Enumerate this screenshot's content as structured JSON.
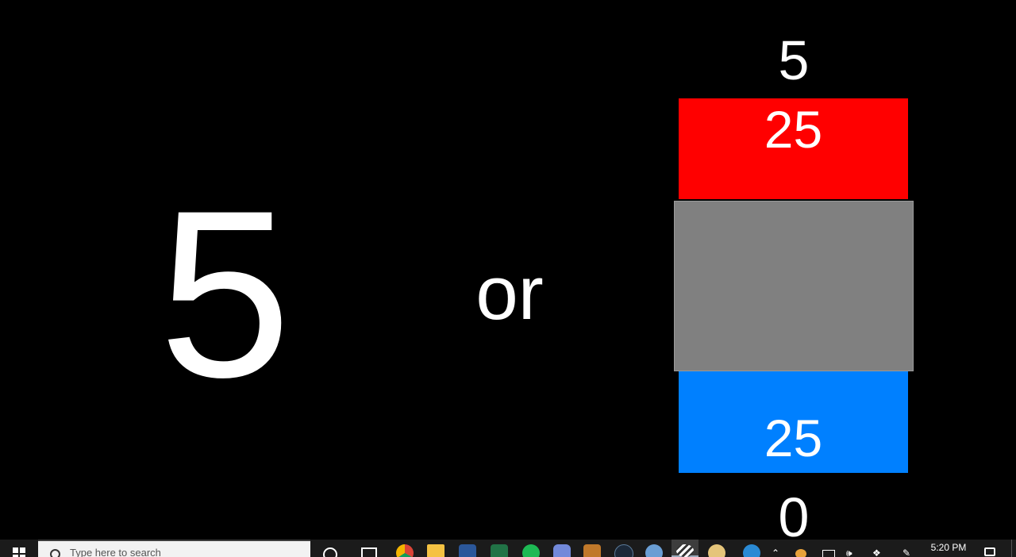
{
  "slide": {
    "main_number": "5",
    "connector": "or",
    "top_value": "5",
    "red_label": "25",
    "blue_label": "25",
    "bottom_value": "0",
    "colors": {
      "background": "#000000",
      "red": "#ff0000",
      "gray": "#808080",
      "blue": "#0080ff",
      "text": "#ffffff"
    }
  },
  "taskbar": {
    "search_placeholder": "Type here to search",
    "clock_time": "5:20 PM",
    "pinned_icons": [
      "chrome-icon",
      "file-explorer-icon",
      "word-icon",
      "excel-icon",
      "spotify-icon",
      "discord-icon",
      "game-icon",
      "steam-icon",
      "r-icon",
      "active-app-icon",
      "paint-icon"
    ]
  }
}
